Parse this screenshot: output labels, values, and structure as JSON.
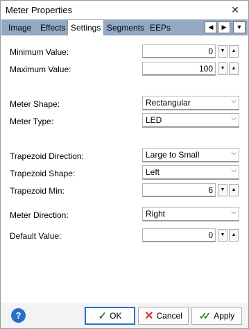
{
  "window": {
    "title": "Meter Properties",
    "close_glyph": "✕"
  },
  "tabs": [
    {
      "label": "Image"
    },
    {
      "label": "Effects"
    },
    {
      "label": "Settings",
      "active": true
    },
    {
      "label": "Segments"
    },
    {
      "label": "EEPs"
    }
  ],
  "tab_scroll": {
    "left": "◀",
    "right": "▶",
    "menu": "▼"
  },
  "settings": {
    "min_value_label": "Minimum Value:",
    "min_value": "0",
    "max_value_label": "Maximum Value:",
    "max_value": "100",
    "meter_shape_label": "Meter Shape:",
    "meter_shape": "Rectangular",
    "meter_type_label": "Meter Type:",
    "meter_type": "LED",
    "trap_direction_label": "Trapezoid Direction:",
    "trap_direction": "Large to Small",
    "trap_shape_label": "Trapezoid Shape:",
    "trap_shape": "Left",
    "trap_min_label": "Trapezoid Min:",
    "trap_min": "6",
    "meter_direction_label": "Meter Direction:",
    "meter_direction": "Right",
    "default_value_label": "Default Value:",
    "default_value": "0"
  },
  "glyphs": {
    "spin_down": "▼",
    "spin_up": "▲",
    "combo_arrow": "⌵"
  },
  "footer": {
    "help": "?",
    "ok_label": "OK",
    "cancel_label": "Cancel",
    "apply_label": "Apply",
    "ok_glyph": "✓",
    "cancel_glyph": "✕",
    "apply_glyph": "✓✓"
  },
  "colors": {
    "tab_bar": "#93a9c3",
    "accent": "#2a6fc9",
    "ok_green": "#1f8a1f",
    "cancel_red": "#d12b2b"
  }
}
